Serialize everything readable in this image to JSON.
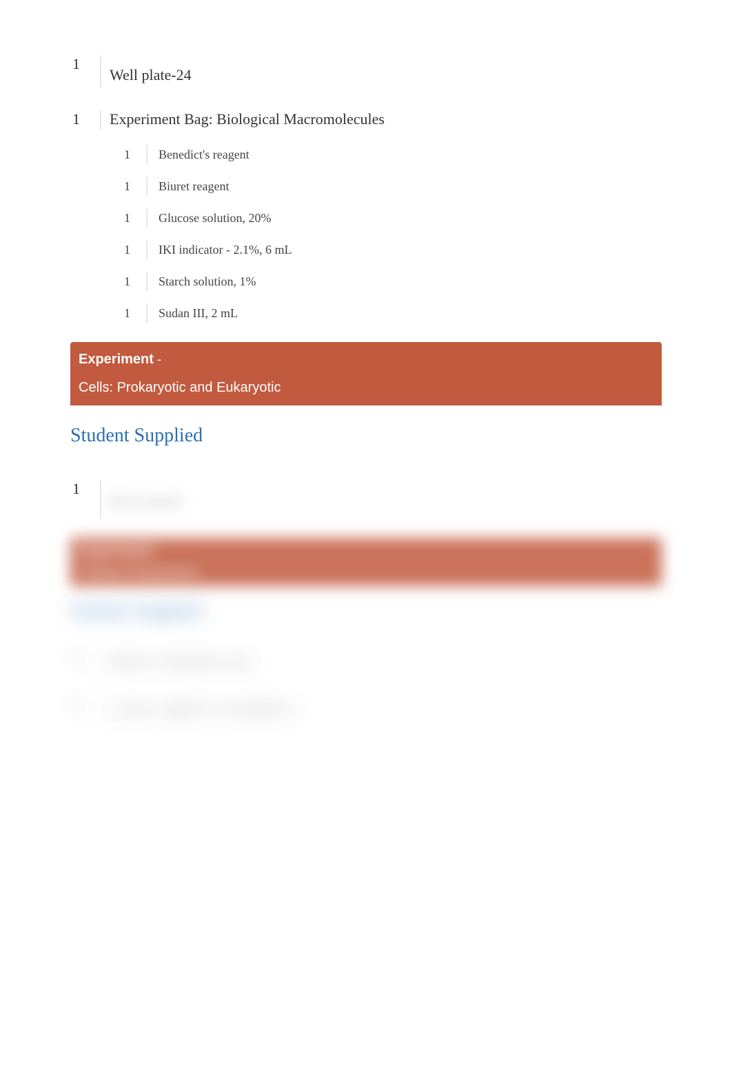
{
  "items_top": [
    {
      "qty": "1",
      "name": "Well plate-24",
      "offset": true
    },
    {
      "qty": "1",
      "name": "Experiment Bag: Biological Macromolecules",
      "offset": false
    }
  ],
  "sub_items": [
    {
      "qty": "1",
      "name": "Benedict's reagent"
    },
    {
      "qty": "1",
      "name": "Biuret reagent"
    },
    {
      "qty": "1",
      "name": "Glucose solution, 20%"
    },
    {
      "qty": "1",
      "name": "IKI indicator - 2.1%, 6 mL"
    },
    {
      "qty": "1",
      "name": "Starch solution, 1%"
    },
    {
      "qty": "1",
      "name": "Sudan III, 2 mL"
    }
  ],
  "experiment1": {
    "label": "Experiment",
    "dash": " -",
    "title": "Cells: Prokaryotic and Eukaryotic"
  },
  "section1_heading": "Student Supplied",
  "section1_items": [
    {
      "qty": "1",
      "name": "Pen or pencil"
    }
  ],
  "experiment2": {
    "label": "Experiment",
    "title": "Cellular Respiration"
  },
  "section2_heading": "Student Supplied",
  "section2_items": [
    {
      "qty": "1",
      "name": "Bottle of distilled water"
    },
    {
      "qty": "1",
      "name": "Camera, digital or smartphone"
    }
  ]
}
